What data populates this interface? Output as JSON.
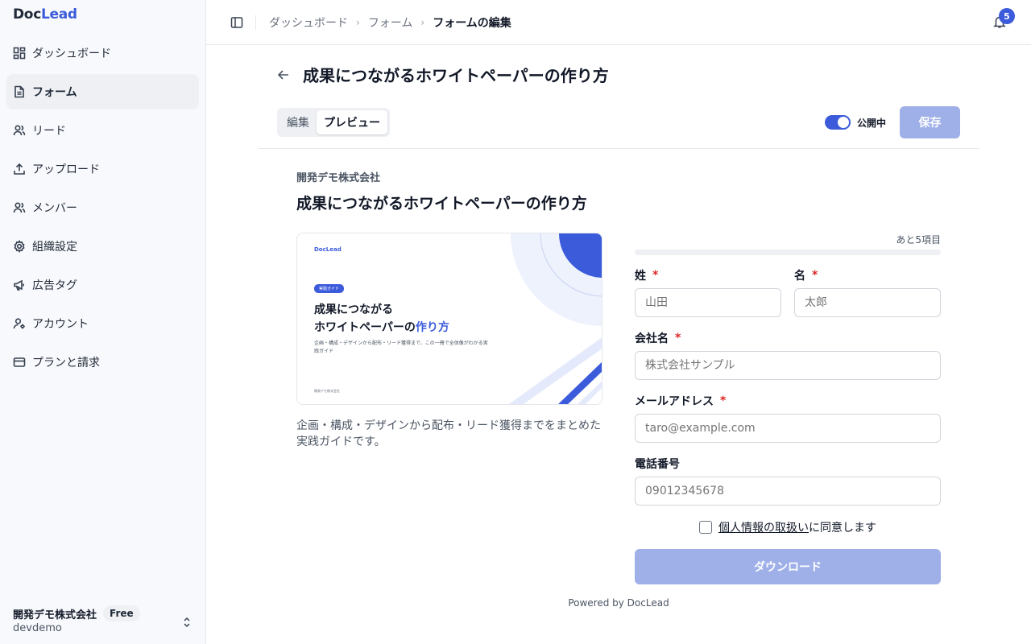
{
  "sidebar": {
    "logo_doc": "Doc",
    "logo_lead": "Lead",
    "items": [
      {
        "label": "ダッシュボード",
        "icon": "dashboard-icon"
      },
      {
        "label": "フォーム",
        "icon": "document-icon",
        "active": true
      },
      {
        "label": "リード",
        "icon": "users-icon"
      },
      {
        "label": "アップロード",
        "icon": "upload-icon"
      },
      {
        "label": "メンバー",
        "icon": "members-icon"
      },
      {
        "label": "組織設定",
        "icon": "gear-icon"
      },
      {
        "label": "広告タグ",
        "icon": "megaphone-icon"
      },
      {
        "label": "アカウント",
        "icon": "user-cog-icon"
      },
      {
        "label": "プランと請求",
        "icon": "credit-card-icon"
      }
    ],
    "org_name": "開発デモ株式会社",
    "plan": "Free",
    "org_slug": "devdemo"
  },
  "topbar": {
    "breadcrumb": [
      "ダッシュボード",
      "フォーム",
      "フォームの編集"
    ],
    "notification_count": "5"
  },
  "page": {
    "title": "成果につながるホワイトペーパーの作り方",
    "tabs": [
      "編集",
      "プレビュー"
    ],
    "active_tab": "プレビュー",
    "publish_label": "公開中",
    "published": true,
    "save_label": "保存"
  },
  "preview": {
    "company": "開発デモ株式会社",
    "title": "成果につながるホワイトペーパーの作り方",
    "cover": {
      "logo": "DocLead",
      "tag": "実践ガイド",
      "title_line1": "成果につながる",
      "title_line2_plain": "ホワイトペーパーの",
      "title_line2_accent": "作り方",
      "subtitle": "企画・構成・デザインから配布・リード獲得まで、この一冊で全体像がわかる実践ガイド",
      "footer": "開発デモ株式会社"
    },
    "description": "企画・構成・デザインから配布・リード獲得までをまとめた実践ガイドです。",
    "form": {
      "remaining": "あと5項目",
      "progress": 0,
      "fields": {
        "last_name": {
          "label": "姓",
          "placeholder": "山田"
        },
        "first_name": {
          "label": "名",
          "placeholder": "太郎"
        },
        "company": {
          "label": "会社名",
          "placeholder": "株式会社サンプル"
        },
        "email": {
          "label": "メールアドレス",
          "placeholder": "taro@example.com"
        },
        "phone": {
          "label": "電話番号",
          "placeholder": "09012345678"
        }
      },
      "required_mark": "*",
      "consent_link": "個人情報の取扱い",
      "consent_text": "に同意します",
      "download_label": "ダウンロード"
    },
    "powered_by": "Powered by DocLead"
  },
  "colors": {
    "accent": "#3b5bdb",
    "accent_disabled": "#9fb0e8",
    "required": "#dc2626"
  }
}
